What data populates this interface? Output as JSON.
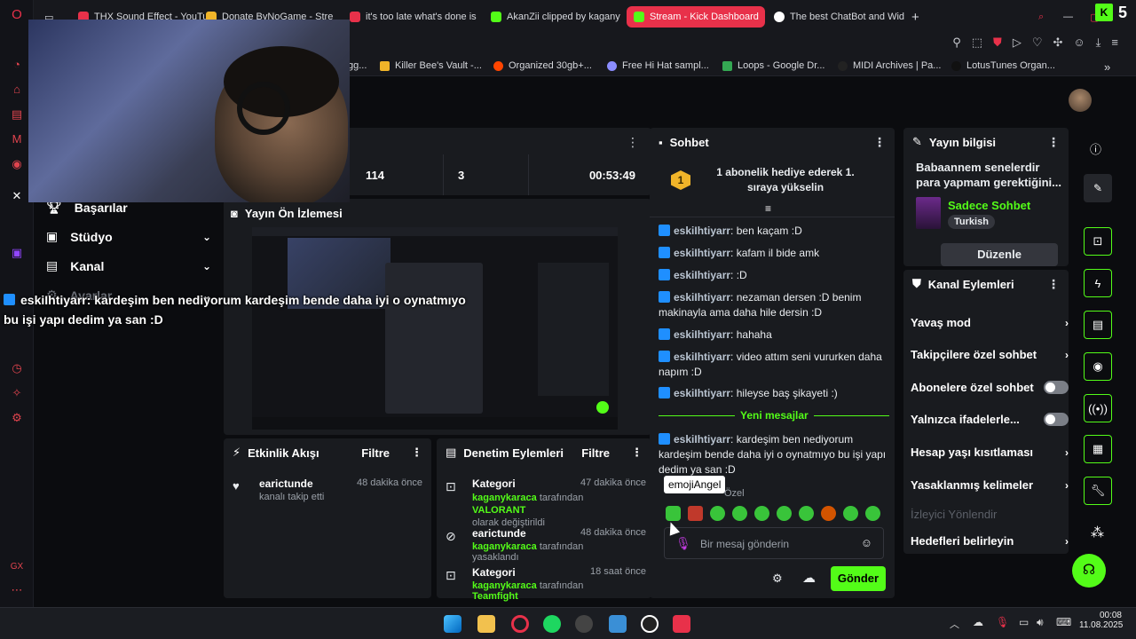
{
  "tabs": [
    {
      "label": "THX Sound Effect - YouTu",
      "color": "#e8314a"
    },
    {
      "label": "Donate ByNoGame - Stre",
      "color": "#f0b429"
    },
    {
      "label": "it's too late what's done is",
      "color": "#e8314a"
    },
    {
      "label": "AkanZii clipped by kagany",
      "color": "#53fc18"
    },
    {
      "label": "Stream - Kick Dashboard",
      "color": "#53fc18"
    },
    {
      "label": "The best ChatBot and Wid",
      "color": "#ffffff"
    }
  ],
  "tab_badge": "5",
  "bookmarks": [
    "gg...",
    "Killer Bee's Vault -...",
    "Organized 30gb+...",
    "Free Hi Hat sampl...",
    "Loops - Google Dr...",
    "MIDI Archives | Pa...",
    "LotusTunes Organ..."
  ],
  "overlay_chat": {
    "user": "eskiIhtiyarr",
    "line1": ": kardeşim ben nediyorum kardeşim bende daha iyi o oynatmıyo",
    "line2": "bu işi yapı dedim ya san :D"
  },
  "left_nav": {
    "items": [
      {
        "label": "Başarılar"
      },
      {
        "label": "Stüdyo"
      },
      {
        "label": "Kanal"
      },
      {
        "label": "Ayarlar"
      }
    ]
  },
  "stats": {
    "viewers": "114",
    "followers": "3",
    "uptime": "00:53:49"
  },
  "preview": {
    "title": "Yayın Ön İzlemesi"
  },
  "activity": {
    "title": "Etkinlik Akışı",
    "filter": "Filtre",
    "items": [
      {
        "user": "earictunde",
        "time": "48 dakika önce",
        "desc": "kanalı takip etti"
      }
    ]
  },
  "moderation": {
    "title": "Denetim Eylemleri",
    "filter": "Filtre",
    "items": [
      {
        "title": "Kategori",
        "time": "47 dakika önce",
        "by": "kaganykaraca",
        "mid": " tarafından ",
        "target": "VALORANT",
        "suffix": "olarak değiştirildi"
      },
      {
        "title": "earictunde",
        "time": "48 dakika önce",
        "by": "kaganykaraca",
        "mid": " tarafından yasaklandı",
        "target": "",
        "suffix": ""
      },
      {
        "title": "Kategori",
        "time": "18 saat önce",
        "by": "kaganykaraca",
        "mid": " tarafından ",
        "target": "Teamfight",
        "suffix": ""
      }
    ]
  },
  "chat": {
    "title": "Sohbet",
    "pinned": "1 abonelik hediye ederek 1. sıraya yükselin",
    "pinned_rank": "1",
    "messages": [
      {
        "user": "eskiIhtiyarr",
        "text": " ben kaçam :D"
      },
      {
        "user": "eskiIhtiyarr",
        "text": " kafam il bide amk"
      },
      {
        "user": "eskiIhtiyarr",
        "text": " :D"
      },
      {
        "user": "eskiIhtiyarr",
        "text": " nezaman dersen :D benim makinayla ama daha hile dersin :D"
      },
      {
        "user": "eskiIhtiyarr",
        "text": " hahaha"
      },
      {
        "user": "eskiIhtiyarr",
        "text": " video attım seni vururken daha napım :D"
      },
      {
        "user": "eskiIhtiyarr",
        "text": " hileyse baş şikayeti :)"
      }
    ],
    "new_messages": "Yeni mesajlar",
    "last_message": {
      "user": "eskiIhtiyarr",
      "text": " kardeşim ben nediyorum kardeşim bende daha iyi o oynatmıyo bu işi yapı dedim ya san :D"
    },
    "tooltip": "emojiAngel",
    "emote_section": "Özel",
    "input_placeholder": "Bir mesaj gönderin",
    "send": "Gönder"
  },
  "stream_info": {
    "title": "Yayın bilgisi",
    "stream_title": "Babaannem senelerdir para yapmam gerektiğini...",
    "category": "Sadece Sohbet",
    "language": "Turkish",
    "edit": "Düzenle"
  },
  "channel_actions": {
    "title": "Kanal Eylemleri",
    "items": [
      {
        "label": "Yavaş mod",
        "kind": "chevron"
      },
      {
        "label": "Takipçilere özel sohbet",
        "kind": "chevron"
      },
      {
        "label": "Abonelere özel sohbet",
        "kind": "toggle"
      },
      {
        "label": "Yalnızca ifadelerle...",
        "kind": "toggle"
      },
      {
        "label": "Hesap yaşı kısıtlaması",
        "kind": "chevron"
      },
      {
        "label": "Yasaklanmış kelimeler",
        "kind": "chevron"
      },
      {
        "label": "İzleyici Yönlendir",
        "kind": "disabled"
      },
      {
        "label": "Hedefleri belirleyin",
        "kind": "chevron"
      }
    ]
  },
  "taskbar": {
    "time": "00:08",
    "date": "11.08.2025"
  }
}
